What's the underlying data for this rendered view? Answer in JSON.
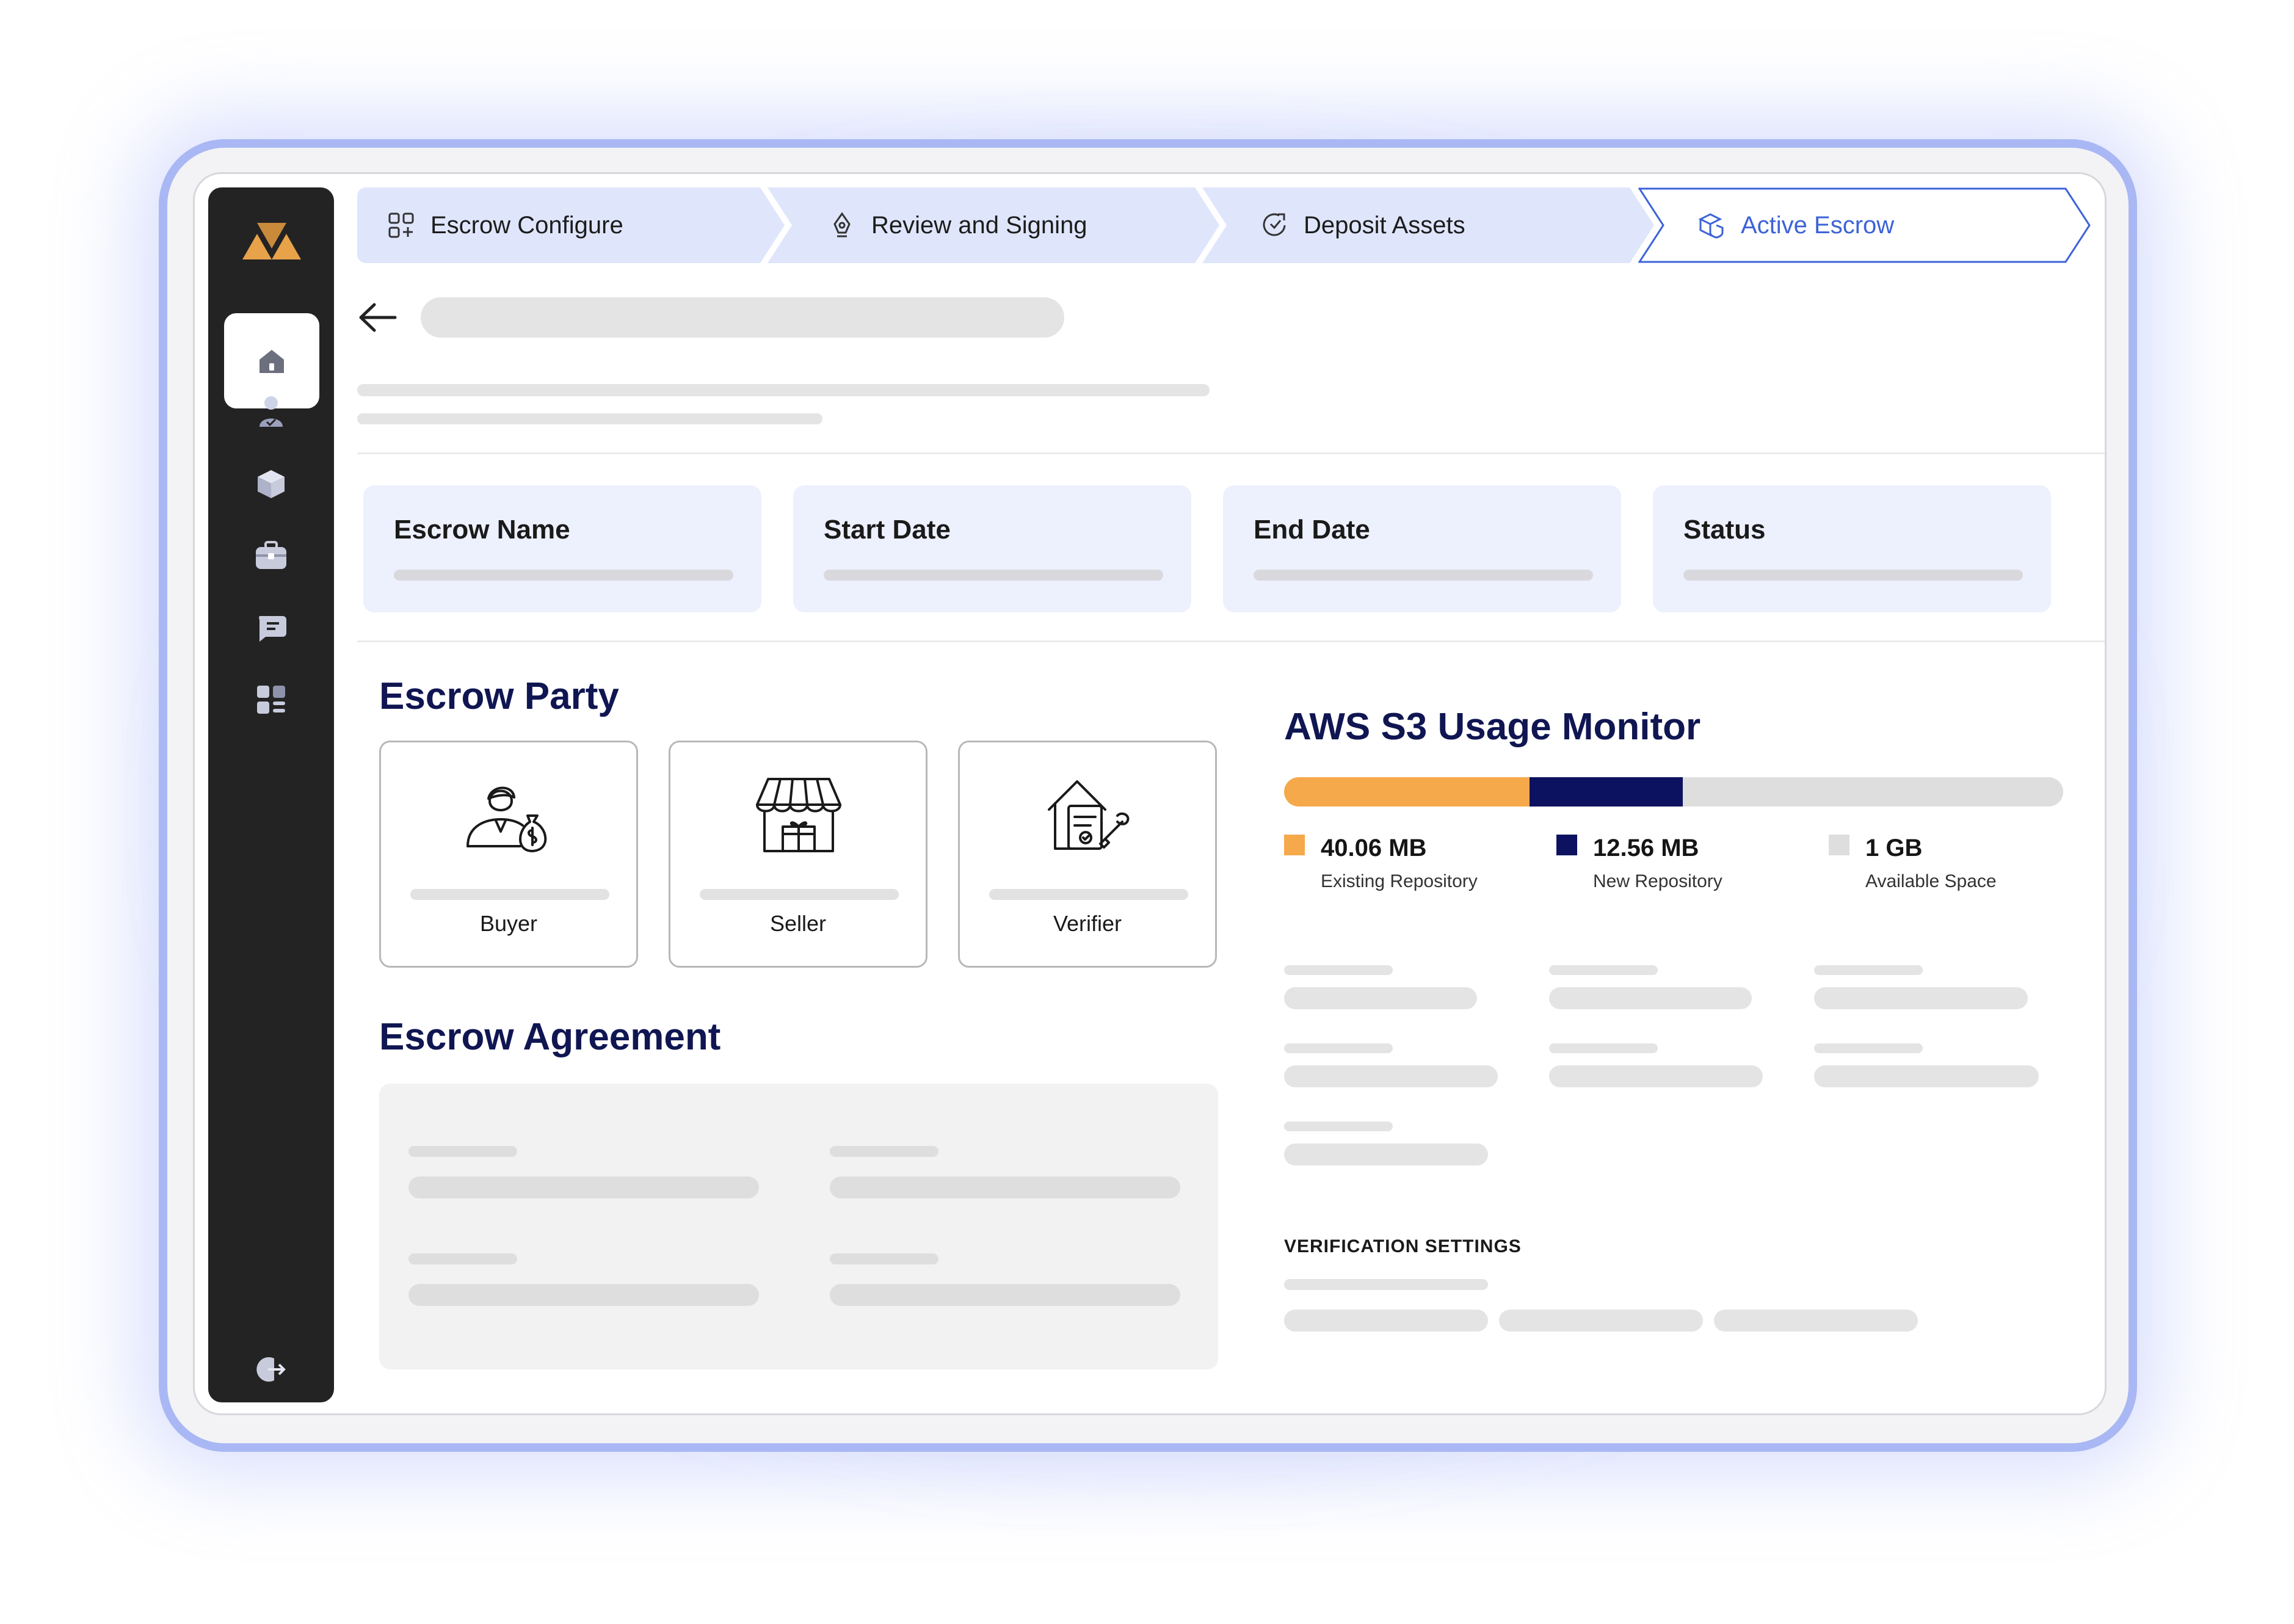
{
  "stepper": {
    "steps": [
      {
        "label": "Escrow Configure",
        "icon": "grid-add-icon"
      },
      {
        "label": "Review and Signing",
        "icon": "pen-nib-icon"
      },
      {
        "label": "Deposit Assets",
        "icon": "deposit-arrow-icon"
      },
      {
        "label": "Active Escrow",
        "icon": "box-shield-icon"
      }
    ],
    "active_index": 3
  },
  "sidebar": {
    "items": [
      "home-icon",
      "user-check-icon",
      "cube-icon",
      "briefcase-icon",
      "chat-icon",
      "dashboard-icon"
    ],
    "logout": "logout-icon"
  },
  "info_cards": [
    {
      "label": "Escrow Name"
    },
    {
      "label": "Start Date"
    },
    {
      "label": "End Date"
    },
    {
      "label": "Status"
    }
  ],
  "escrow_party": {
    "title": "Escrow Party",
    "parties": [
      {
        "label": "Buyer",
        "icon": "buyer-icon"
      },
      {
        "label": "Seller",
        "icon": "seller-store-icon"
      },
      {
        "label": "Verifier",
        "icon": "verifier-icon"
      }
    ]
  },
  "agreement": {
    "title": "Escrow Agreement"
  },
  "usage": {
    "title": "AWS S3 Usage Monitor",
    "items": [
      {
        "value": "40.06 MB",
        "caption": "Existing Repository",
        "color": "#f5a94a",
        "fraction": 0.315
      },
      {
        "value": "12.56 MB",
        "caption": "New Repository",
        "color": "#0d1260",
        "fraction": 0.197
      },
      {
        "value": "1 GB",
        "caption": "Available Space",
        "color": "#dedede",
        "fraction": 0.488
      }
    ]
  },
  "verification": {
    "title": "VERIFICATION SETTINGS"
  },
  "colors": {
    "accent": "#3d63d8",
    "navy": "#101652",
    "step_bg": "#dfe6fc",
    "card_bg": "#edf0fd",
    "sidebar_bg": "#232323",
    "frame": "#a9b8f4"
  }
}
